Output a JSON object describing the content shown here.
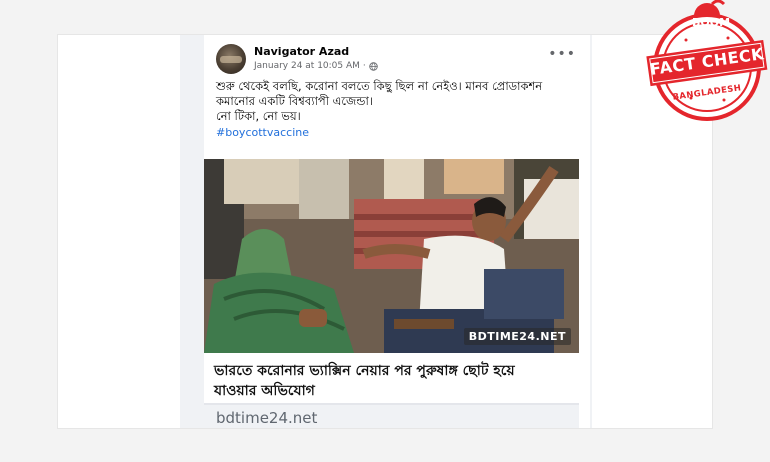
{
  "post": {
    "author": "Navigator Azad",
    "timestamp": "January 24 at 10:05 AM",
    "separator": "·",
    "privacy_icon": "globe-icon",
    "more_label": "•••",
    "text_lines": [
      "শুরু থেকেই বলছি, করোনা বলতে কিছু ছিল না নেইও। মানব প্রোডাকশন",
      "কমানোর একটি বিশ্বব্যাপী এজেন্ডা।",
      "নো টিকা,  নো ভয়।"
    ],
    "hashtag": "#boycottvaccine"
  },
  "link_card": {
    "watermark": "BDTIME24.NET",
    "title_lines": [
      "ভারতে করোনার ভ্যাক্সিন নেয়ার পর পুরুষাঙ্গ ছোট হয়ে",
      "যাওয়ার অভিযোগ"
    ],
    "domain": "bdtime24.net"
  },
  "stamp": {
    "top_word": "BOOM",
    "main_text": "FACT CHECK",
    "country": "BANGLADESH",
    "color": "#e4262c"
  }
}
